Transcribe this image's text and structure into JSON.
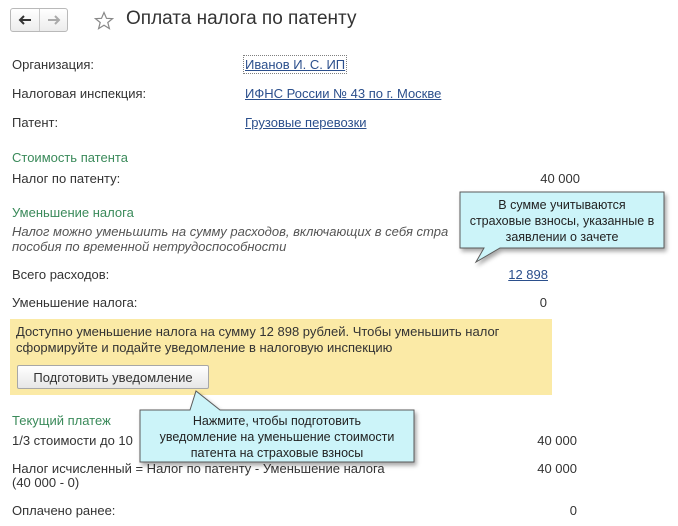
{
  "header": {
    "back_icon": "arrow-left-icon",
    "forward_icon": "arrow-right-icon",
    "favorite_icon": "star-icon",
    "title": "Оплата налога по патенту"
  },
  "fields": {
    "organization_label": "Организация:",
    "organization_value": "Иванов И. С. ИП",
    "inspection_label": "Налоговая инспекция:",
    "inspection_value": "ИФНС России № 43 по г. Москве",
    "patent_label": "Патент:",
    "patent_value": "Грузовые перевозки"
  },
  "cost_section": {
    "title": "Стоимость патента",
    "tax_label": "Налог по патенту:",
    "tax_value": "40 000"
  },
  "reduction_section": {
    "title": "Уменьшение налога",
    "note_line1": "Налог можно уменьшить на сумму расходов, включающих в себя стра",
    "note_line2": "пособия по временной нетрудоспособности",
    "expenses_label": "Всего расходов:",
    "expenses_value": "12 898",
    "reduction_label": "Уменьшение налога:",
    "reduction_value": "0"
  },
  "notice": {
    "text": "Доступно уменьшение налога на сумму 12 898 рублей. Чтобы уменьшить налог сформируйте и подайте уведомление в налоговую инспекцию",
    "button_label": "Подготовить уведомление",
    "background_color": "#fbeaa6"
  },
  "current_payment": {
    "title": "Текущий платеж",
    "third_label": "1/3 стоимости до 10",
    "third_value": "40 000",
    "calc_label": "Налог исчисленный = Налог по патенту - Уменьшение налога",
    "calc_sub": "(40 000 - 0)",
    "calc_value": "40 000",
    "paid_label": "Оплачено ранее:",
    "paid_value": "0"
  },
  "callouts": {
    "top": {
      "line1": "В сумме учитываются",
      "line2": "страховые взносы, указанные в",
      "line3": "заявлении о зачете"
    },
    "bottom": {
      "line1": "Нажмите, чтобы подготовить",
      "line2": "уведомление на уменьшение стоимости",
      "line3": "патента на страховые взносы"
    },
    "fill_color": "#ccf4f9",
    "border_color": "#5a5a5a"
  }
}
